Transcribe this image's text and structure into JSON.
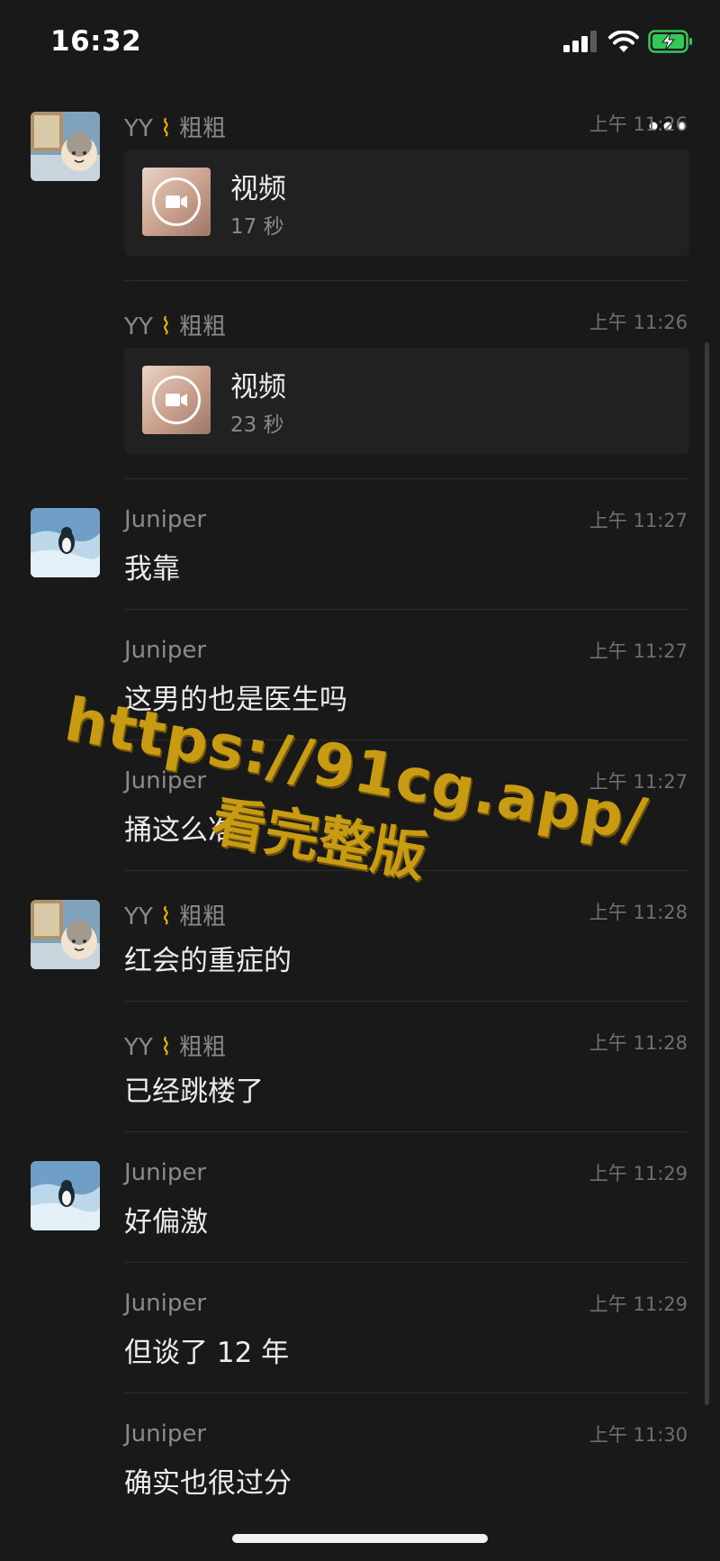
{
  "status_bar": {
    "time": "16:32"
  },
  "messages": [
    {
      "sender_name": "YY",
      "sender_suffix": "粗粗",
      "time": "上午 11:26",
      "type": "video",
      "video_title": "视频",
      "video_duration": "17 秒",
      "avatar": "grandma-cartoon"
    },
    {
      "sender_name": "YY",
      "sender_suffix": "粗粗",
      "time": "上午 11:26",
      "type": "video",
      "video_title": "视频",
      "video_duration": "23 秒"
    },
    {
      "sender_name": "Juniper",
      "time": "上午 11:27",
      "text": "我靠",
      "avatar": "penguin-ice"
    },
    {
      "sender_name": "Juniper",
      "time": "上午 11:27",
      "text": "这男的也是医生吗"
    },
    {
      "sender_name": "Juniper",
      "time": "上午 11:27",
      "text": "捅这么准"
    },
    {
      "sender_name": "YY",
      "sender_suffix": "粗粗",
      "time": "上午 11:28",
      "text": "红会的重症的",
      "avatar": "grandma-cartoon"
    },
    {
      "sender_name": "YY",
      "sender_suffix": "粗粗",
      "time": "上午 11:28",
      "text": "已经跳楼了"
    },
    {
      "sender_name": "Juniper",
      "time": "上午 11:29",
      "text": "好偏激",
      "avatar": "penguin-ice"
    },
    {
      "sender_name": "Juniper",
      "time": "上午 11:29",
      "text": "但谈了 12 年"
    },
    {
      "sender_name": "Juniper",
      "time": "上午 11:30",
      "text": "确实也很过分"
    }
  ],
  "watermark": {
    "url": "https://91cg.app/",
    "caption": "看完整版"
  },
  "icons": {
    "back": "back-arrow-icon",
    "more": "more-dots-icon",
    "signal": "cellular-signal-icon",
    "wifi": "wifi-icon",
    "battery": "battery-charging-icon",
    "video_play": "video-camera-icon",
    "sender_emoji": "leg-emoji-icon"
  },
  "colors": {
    "background": "#191919",
    "watermark": "#c89b13",
    "battery": "#34c759"
  }
}
